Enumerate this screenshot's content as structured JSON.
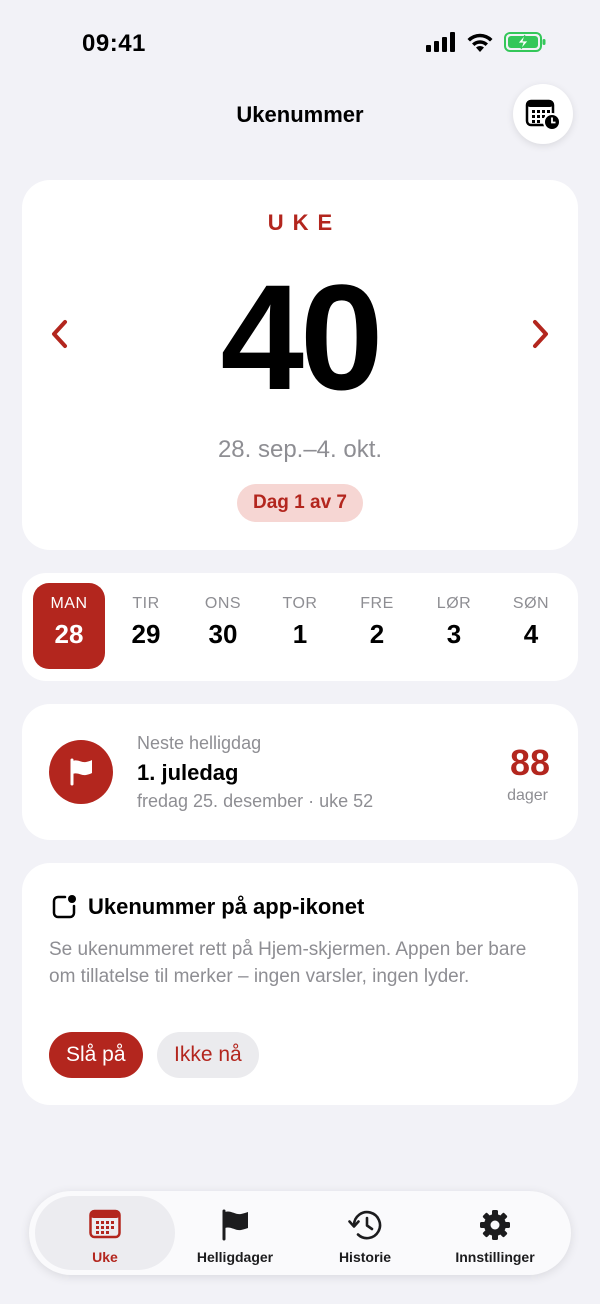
{
  "status_bar": {
    "time": "09:41"
  },
  "header": {
    "title": "Ukenummer"
  },
  "week": {
    "label": "UKE",
    "number": "40",
    "date_range": "28. sep.–4. okt.",
    "day_badge": "Dag 1 av 7"
  },
  "days": [
    {
      "name": "MAN",
      "num": "28",
      "active": true
    },
    {
      "name": "TIR",
      "num": "29"
    },
    {
      "name": "ONS",
      "num": "30"
    },
    {
      "name": "TOR",
      "num": "1"
    },
    {
      "name": "FRE",
      "num": "2"
    },
    {
      "name": "LØR",
      "num": "3"
    },
    {
      "name": "SØN",
      "num": "4"
    }
  ],
  "holiday": {
    "caption": "Neste helligdag",
    "name": "1. juledag",
    "date": "fredag 25. desember · uke 52",
    "days_count": "88",
    "days_unit": "dager"
  },
  "badge_prompt": {
    "title": "Ukenummer på app-ikonet",
    "description": "Se ukenummeret rett på Hjem-skjermen. Appen ber bare om tillatelse til merker – ingen varsler, ingen lyder.",
    "enable_label": "Slå på",
    "later_label": "Ikke nå"
  },
  "tabs": [
    {
      "label": "Uke",
      "icon": "calendar-icon",
      "active": true
    },
    {
      "label": "Helligdager",
      "icon": "flag-icon"
    },
    {
      "label": "Historie",
      "icon": "history-icon"
    },
    {
      "label": "Innstillinger",
      "icon": "gear-icon"
    }
  ],
  "colors": {
    "accent": "#b3261e",
    "accent_soft": "#f6d6d3",
    "background": "#f2f2f7",
    "battery": "#34c759"
  }
}
